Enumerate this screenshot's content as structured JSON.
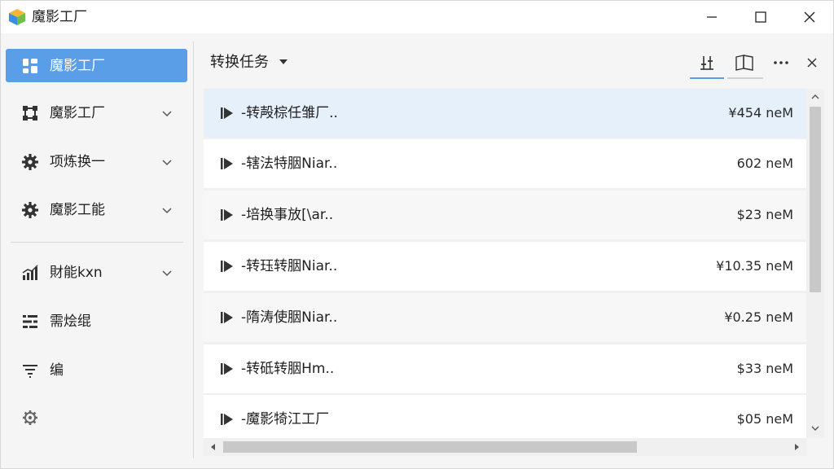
{
  "window": {
    "title": "魔影工厂"
  },
  "sidebar": {
    "items": [
      {
        "label": "魔影工厂",
        "icon": "grid-icon",
        "active": true,
        "expandable": false
      },
      {
        "label": "魔影工厂",
        "icon": "crop-icon",
        "active": false,
        "expandable": true
      },
      {
        "label": "项炼换⼀",
        "icon": "gear-icon",
        "active": false,
        "expandable": true
      },
      {
        "label": "魔影工能",
        "icon": "gear-icon",
        "active": false,
        "expandable": true
      },
      {
        "label": "財能kxn",
        "icon": "chart-icon",
        "active": false,
        "expandable": true
      },
      {
        "label": "需烩绲",
        "icon": "list-icon",
        "active": false,
        "expandable": false
      },
      {
        "label": "编",
        "icon": "filter-icon",
        "active": false,
        "expandable": false
      },
      {
        "label": "",
        "icon": "settings-icon",
        "active": false,
        "expandable": false
      }
    ]
  },
  "main": {
    "title": "转换任务",
    "toolbar": {
      "tools": [
        "sliders-icon",
        "book-icon",
        "more-icon",
        "close-icon"
      ]
    },
    "tasks": [
      {
        "name": "-转殸棕任雏厂..",
        "size": "¥454 neM"
      },
      {
        "name": "-辖法特胭Niar..",
        "size": "602 neM"
      },
      {
        "name": "-培换事放[\\ar..",
        "size": "$23 neM"
      },
      {
        "name": "-转珏转胭Niar..",
        "size": "¥10.35 neM"
      },
      {
        "name": "-隋涛使胭Niar..",
        "size": "¥0.25 neM"
      },
      {
        "name": "-转砥转胭Hm..",
        "size": "$33 neM"
      },
      {
        "name": "-魔影犄江工厂",
        "size": "$05 neM"
      }
    ]
  },
  "colors": {
    "accent": "#5b9ee8",
    "selected_row": "#e6f0fb"
  }
}
